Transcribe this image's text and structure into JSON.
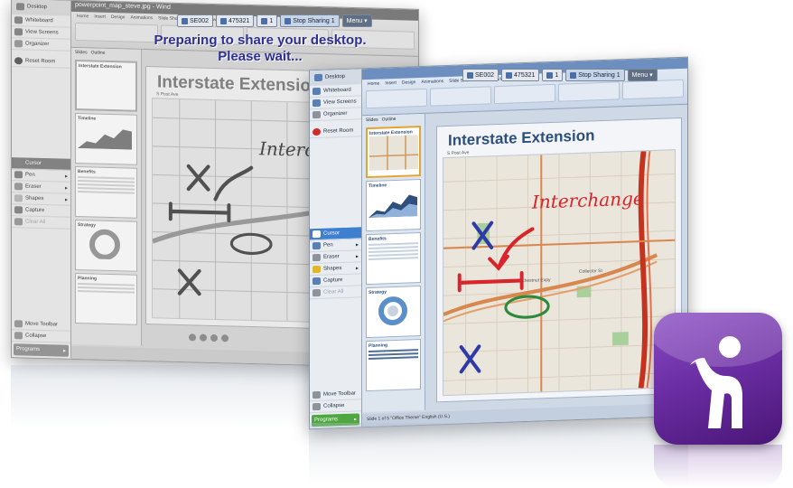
{
  "back_window": {
    "title": "powerpoint_map_steve.jpg - Wind",
    "overlay_line1": "Preparing to share your desktop.",
    "overlay_line2": "Please wait...",
    "slide_title": "Interstate Extension",
    "annotation": "Interchange"
  },
  "share_bar_back": {
    "session": "SE002",
    "code": "475321",
    "count": "1",
    "stop": "Stop Sharing 1",
    "menu": "Menu"
  },
  "share_bar_front": {
    "session": "SE002",
    "code": "475321",
    "count": "1",
    "stop": "Stop Sharing 1",
    "menu": "Menu"
  },
  "toolbar": {
    "header": "Desktop",
    "whiteboard": "Whiteboard",
    "view_screens": "View Screens",
    "organizer": "Organizer",
    "reset_room": "Reset Room",
    "cursor": "Cursor",
    "pen": "Pen",
    "eraser": "Eraser",
    "shapes": "Shapes",
    "capture": "Capture",
    "clear_all": "Clear All",
    "move_toolbar": "Move Toolbar",
    "collapse": "Collapse",
    "programs": "Programs"
  },
  "ribbon": {
    "tabs": [
      "Home",
      "Insert",
      "Design",
      "Animations",
      "Slide Show",
      "Review",
      "View"
    ]
  },
  "slides_tabs": [
    "Slides",
    "Outline"
  ],
  "thumbnails": [
    "Interstate Extension",
    "Timeline",
    "Benefits",
    "Strategy",
    "Planning"
  ],
  "front_window": {
    "slide_title": "Interstate Extension",
    "annotation": "Interchange",
    "status": "Slide 1 of 5   \"Office Theme\"   English (U.S.)"
  },
  "map_labels": {
    "street_top": "S Post Ave",
    "connector": "Chestnut Expy",
    "collector": "Collector St"
  },
  "colors": {
    "logo": "#6c2ea5",
    "accent_blue": "#3e7fd0",
    "programs_green": "#4ea83f",
    "ink_red": "#d8252b",
    "ink_blue": "#2f3aa8",
    "ink_green": "#2d8a3a"
  }
}
